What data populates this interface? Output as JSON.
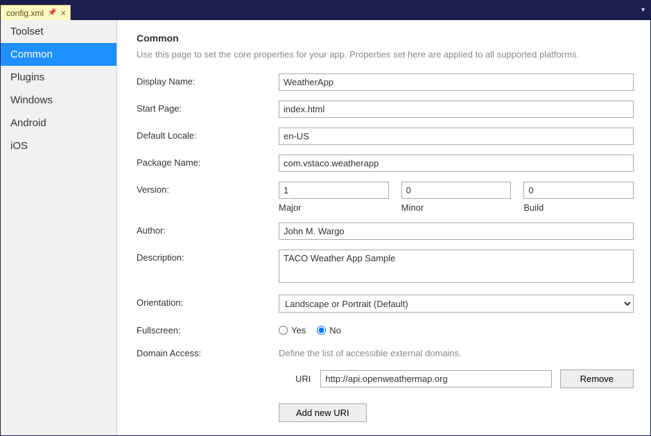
{
  "tab": {
    "filename": "config.xml"
  },
  "sidebar": {
    "items": [
      {
        "label": "Toolset"
      },
      {
        "label": "Common"
      },
      {
        "label": "Plugins"
      },
      {
        "label": "Windows"
      },
      {
        "label": "Android"
      },
      {
        "label": "iOS"
      }
    ],
    "selected_index": 1
  },
  "main": {
    "heading": "Common",
    "description": "Use this page to set the core properties for your app. Properties set here are applied to all supported platforms.",
    "labels": {
      "display_name": "Display Name:",
      "start_page": "Start Page:",
      "default_locale": "Default Locale:",
      "package_name": "Package Name:",
      "version": "Version:",
      "major": "Major",
      "minor": "Minor",
      "build": "Build",
      "author": "Author:",
      "description": "Description:",
      "orientation": "Orientation:",
      "fullscreen": "Fullscreen:",
      "yes": "Yes",
      "no": "No",
      "domain_access": "Domain Access:",
      "domain_desc": "Define the list of accessible external domains.",
      "uri": "URI",
      "remove": "Remove",
      "add_uri": "Add new URI"
    },
    "fields": {
      "display_name": "WeatherApp",
      "start_page": "index.html",
      "default_locale": "en-US",
      "package_name": "com.vstaco.weatherapp",
      "version_major": "1",
      "version_minor": "0",
      "version_build": "0",
      "author": "John M. Wargo",
      "description": "TACO Weather App Sample",
      "orientation": "Landscape or Portrait (Default)",
      "fullscreen": "No",
      "uri": "http://api.openweathermap.org"
    }
  }
}
